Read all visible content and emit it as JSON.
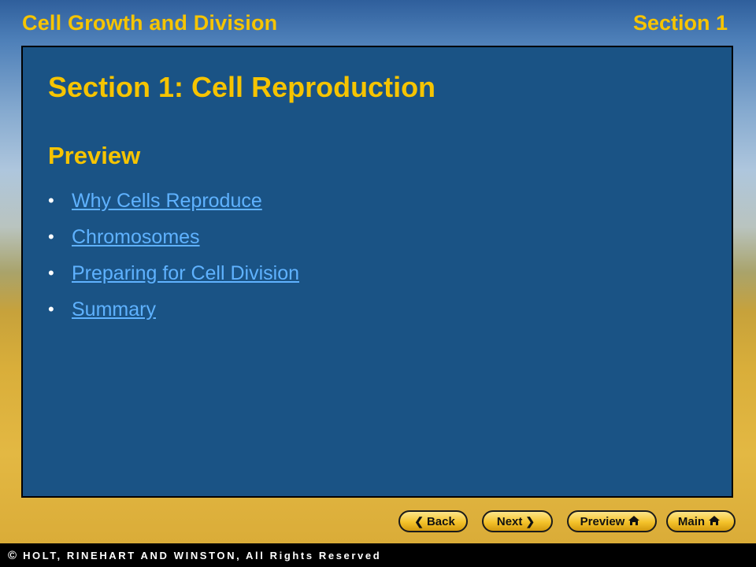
{
  "header": {
    "chapter": "Cell Growth and Division",
    "section": "Section 1"
  },
  "panel": {
    "title": "Section 1: Cell Reproduction",
    "subtitle": "Preview",
    "links": [
      {
        "label": "Why Cells Reproduce",
        "icon": "bullet"
      },
      {
        "label": "Chromosomes",
        "icon": "bullet"
      },
      {
        "label": "Preparing for Cell Division",
        "icon": "bullet"
      },
      {
        "label": "Summary",
        "icon": "bullet"
      }
    ]
  },
  "nav": {
    "back": {
      "label": "Back",
      "icon": "chevron-left-icon"
    },
    "next": {
      "label": "Next",
      "icon": "chevron-right-icon"
    },
    "preview": {
      "label": "Preview",
      "icon": "home-icon"
    },
    "main": {
      "label": "Main",
      "icon": "home-icon"
    }
  },
  "footer": {
    "copyright_symbol": "©",
    "text": "HOLT, RINEHART AND WINSTON, All Rights Reserved"
  },
  "colors": {
    "accent_yellow": "#f6c400",
    "panel_blue": "#1a5385",
    "link_blue": "#5fb2ff"
  }
}
